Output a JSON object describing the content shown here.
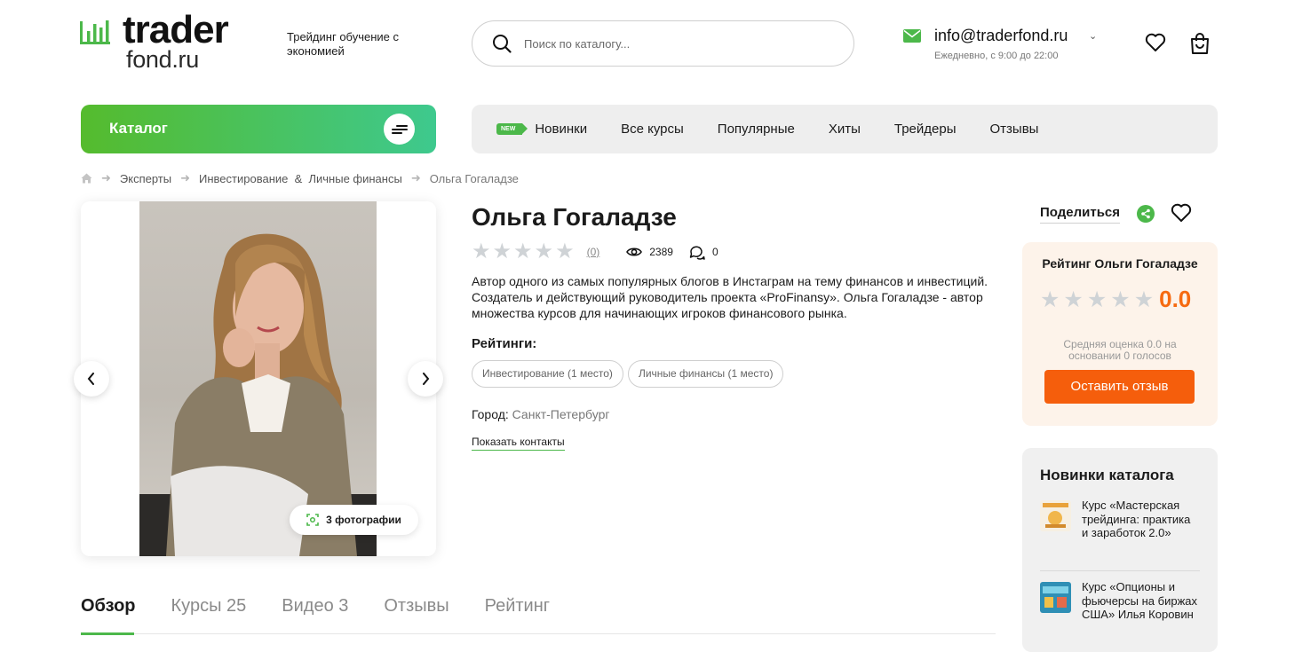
{
  "brand": {
    "word1": "trader",
    "word2": "fond.ru",
    "tagline": "Трейдинг обучение с экономией",
    "accent": "#4cb84a"
  },
  "search": {
    "placeholder": "Поиск по каталогу..."
  },
  "contact": {
    "email": "info@traderfond.ru",
    "hours": "Ежедневно, с 9:00 до 22:00"
  },
  "catalog": {
    "label": "Каталог"
  },
  "nav": {
    "badge": "NEW",
    "items": [
      "Новинки",
      "Все курсы",
      "Популярные",
      "Хиты",
      "Трейдеры",
      "Отзывы"
    ]
  },
  "breadcrumb": {
    "items": [
      "Эксперты",
      "Инвестирование  &  Личные финансы",
      "Ольга Гогаладзе"
    ]
  },
  "gallery": {
    "photos_label": "3 фотографии"
  },
  "expert": {
    "name": "Ольга Гогаладзе",
    "rating_stars": 0,
    "reviews_count": "(0)",
    "views": "2389",
    "comments": "0",
    "description": "Автор одного из самых популярных блогов в Инстаграм на тему финансов и инвестиций. Создатель и действующий руководитель проекта «ProFinansy». Ольга Гогаладзе - автор множества курсов для начинающих игроков финансового рынка.",
    "ratings_label": "Рейтинги:",
    "ratings": [
      "Инвестирование (1 место)",
      "Личные финансы (1 место)"
    ],
    "city_label": "Город:",
    "city": "Санкт-Петербург",
    "show_contacts": "Показать контакты"
  },
  "share": {
    "label": "Поделиться"
  },
  "rating_box": {
    "title": "Рейтинг Ольги Гогаладзе",
    "score": "0.0",
    "subtitle": "Средняя оценка 0.0 на основании 0 голосов",
    "button": "Оставить отзыв",
    "score_color": "#f66a10",
    "button_color": "#f55e0c"
  },
  "news": {
    "title": "Новинки каталога",
    "items": [
      "Курс «Мастерская трейдинга: практика и заработок 2.0»",
      "Курс «Опционы и фьючерсы на биржах США» Илья Коровин"
    ]
  },
  "tabs": [
    "Обзор",
    "Курсы 25",
    "Видео 3",
    "Отзывы",
    "Рейтинг"
  ]
}
